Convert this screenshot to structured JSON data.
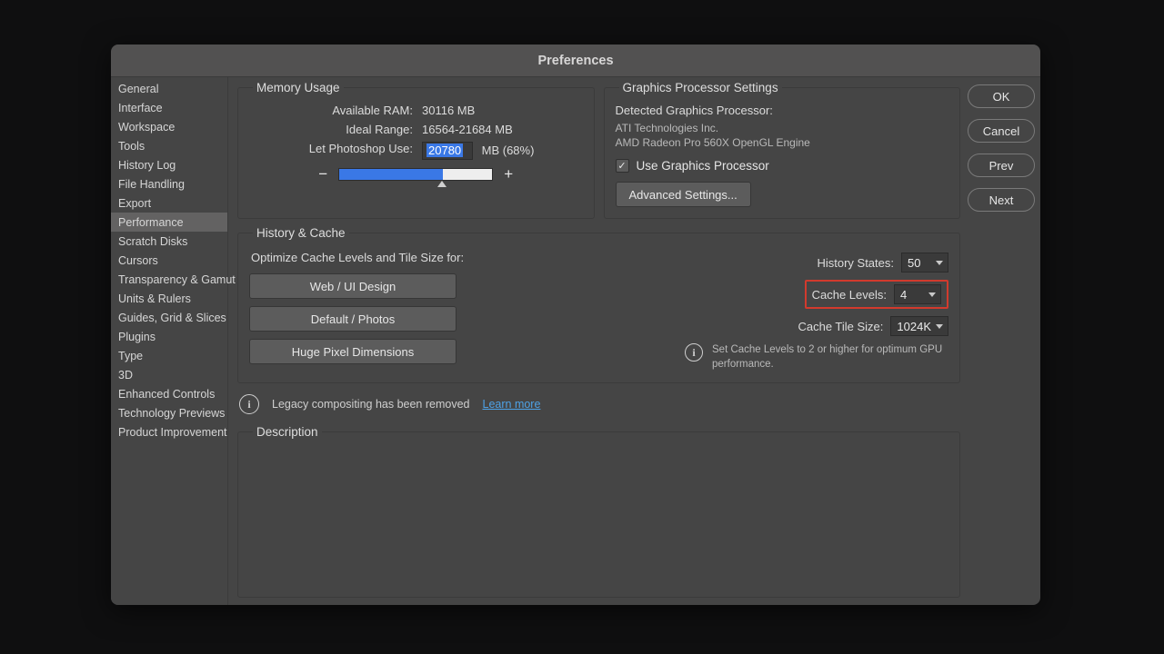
{
  "window": {
    "title": "Preferences"
  },
  "sidebar": {
    "selected_index": 7,
    "items": [
      {
        "label": "General"
      },
      {
        "label": "Interface"
      },
      {
        "label": "Workspace"
      },
      {
        "label": "Tools"
      },
      {
        "label": "History Log"
      },
      {
        "label": "File Handling"
      },
      {
        "label": "Export"
      },
      {
        "label": "Performance"
      },
      {
        "label": "Scratch Disks"
      },
      {
        "label": "Cursors"
      },
      {
        "label": "Transparency & Gamut"
      },
      {
        "label": "Units & Rulers"
      },
      {
        "label": "Guides, Grid & Slices"
      },
      {
        "label": "Plugins"
      },
      {
        "label": "Type"
      },
      {
        "label": "3D"
      },
      {
        "label": "Enhanced Controls"
      },
      {
        "label": "Technology Previews"
      },
      {
        "label": "Product Improvement"
      }
    ]
  },
  "buttons": {
    "ok": "OK",
    "cancel": "Cancel",
    "prev": "Prev",
    "next": "Next"
  },
  "memory": {
    "legend": "Memory Usage",
    "available_label": "Available RAM:",
    "available_value": "30116 MB",
    "ideal_label": "Ideal Range:",
    "ideal_value": "16564-21684 MB",
    "use_label": "Let Photoshop Use:",
    "use_value": "20780",
    "use_suffix": "MB (68%)",
    "minus": "−",
    "plus": "+",
    "slider_percent": 68
  },
  "gpu": {
    "legend": "Graphics Processor Settings",
    "detected_label": "Detected Graphics Processor:",
    "vendor": "ATI Technologies Inc.",
    "model": "AMD Radeon Pro 560X OpenGL Engine",
    "use_label": "Use Graphics Processor",
    "checked": "✓",
    "advanced_label": "Advanced Settings..."
  },
  "history_cache": {
    "legend": "History & Cache",
    "optimize_label": "Optimize Cache Levels and Tile Size for:",
    "opt1": "Web / UI Design",
    "opt2": "Default / Photos",
    "opt3": "Huge Pixel Dimensions",
    "history_states_label": "History States:",
    "history_states_value": "50",
    "cache_levels_label": "Cache Levels:",
    "cache_levels_value": "4",
    "cache_tile_label": "Cache Tile Size:",
    "cache_tile_value": "1024K",
    "info_text": "Set Cache Levels to 2 or higher for optimum GPU performance."
  },
  "legacy": {
    "msg": "Legacy compositing has been removed",
    "learn_more": "Learn more"
  },
  "description": {
    "legend": "Description"
  },
  "icons": {
    "info": "i"
  }
}
